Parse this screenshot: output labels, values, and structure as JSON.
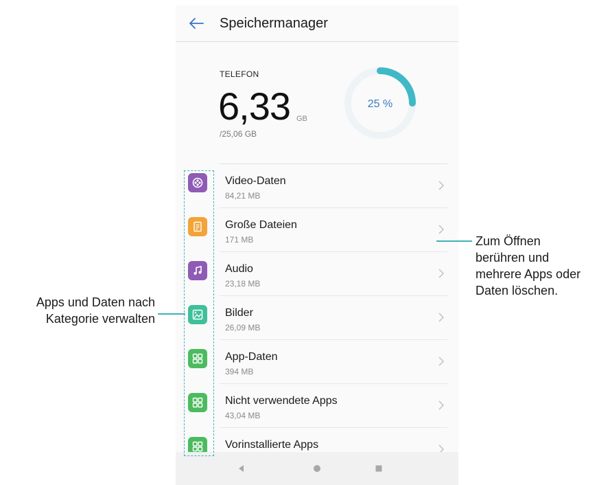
{
  "header": {
    "title": "Speichermanager"
  },
  "storage": {
    "label": "TELEFON",
    "used": "6,33",
    "used_unit": "GB",
    "total": "/25,06 GB",
    "percent_label": "25 %",
    "percent_value": 25
  },
  "categories": [
    {
      "name": "Video-Daten",
      "size": "84,21 MB",
      "icon": "video-icon",
      "color": "#8e5bb5"
    },
    {
      "name": "Große Dateien",
      "size": "171 MB",
      "icon": "document-icon",
      "color": "#f2a33a"
    },
    {
      "name": "Audio",
      "size": "23,18 MB",
      "icon": "music-note-icon",
      "color": "#8e5bb5"
    },
    {
      "name": "Bilder",
      "size": "26,09 MB",
      "icon": "image-icon",
      "color": "#3fbf9b"
    },
    {
      "name": "App-Daten",
      "size": "394 MB",
      "icon": "apps-grid-icon",
      "color": "#4cbb5f"
    },
    {
      "name": "Nicht verwendete Apps",
      "size": "43,04 MB",
      "icon": "apps-grid-icon",
      "color": "#4cbb5f"
    },
    {
      "name": "Vorinstallierte Apps",
      "size": "",
      "icon": "apps-grid-icon",
      "color": "#4cbb5f"
    }
  ],
  "annotations": {
    "left_line1": "Apps und Daten nach",
    "left_line2": "Kategorie verwalten",
    "right_line1": "Zum Öffnen",
    "right_line2": "berühren und",
    "right_line3": "mehrere Apps oder",
    "right_line4": "Daten löschen."
  },
  "colors": {
    "accent": "#3fb2b8",
    "ring_track": "#eef3f5",
    "percent_text": "#3a7bbf"
  }
}
